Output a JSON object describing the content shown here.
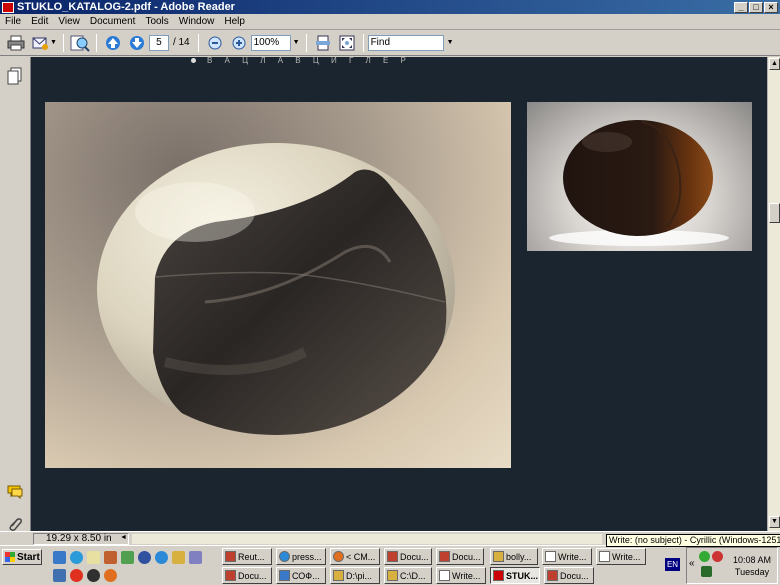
{
  "window": {
    "title": "STUKLO_KATALOG-2.pdf - Adobe Reader",
    "buttons": [
      "_",
      "□",
      "×"
    ]
  },
  "menu": [
    "File",
    "Edit",
    "View",
    "Document",
    "Tools",
    "Window",
    "Help"
  ],
  "toolbar": {
    "current_page": "5",
    "total_pages": "/ 14",
    "zoom": "100%",
    "find_placeholder": "Find"
  },
  "document": {
    "header_text": "В А Ц Л А В   Ц И Г Л Е Р"
  },
  "status": {
    "page_size": "19.29 x 8.50 in",
    "tooltip": "Write: (no subject) - Cyrillic (Windows-1251)"
  },
  "taskbar": {
    "start": "Start",
    "tasks_row1": [
      "Reut...",
      "press...",
      "< CM...",
      "Docu...",
      "Docu...",
      "bolly...",
      "Write...",
      "Write..."
    ],
    "tasks_row2": [
      "Docu...",
      "СОФ...",
      "D:\\pi...",
      "C:\\D...",
      "Write...",
      "STUK...",
      "Docu..."
    ],
    "lang": "EN",
    "time": "10:08 AM",
    "day": "Tuesday"
  },
  "colors": {
    "titlebar": "#0a246a",
    "doc_background": "#1b2530",
    "chrome": "#d4d0c8"
  }
}
